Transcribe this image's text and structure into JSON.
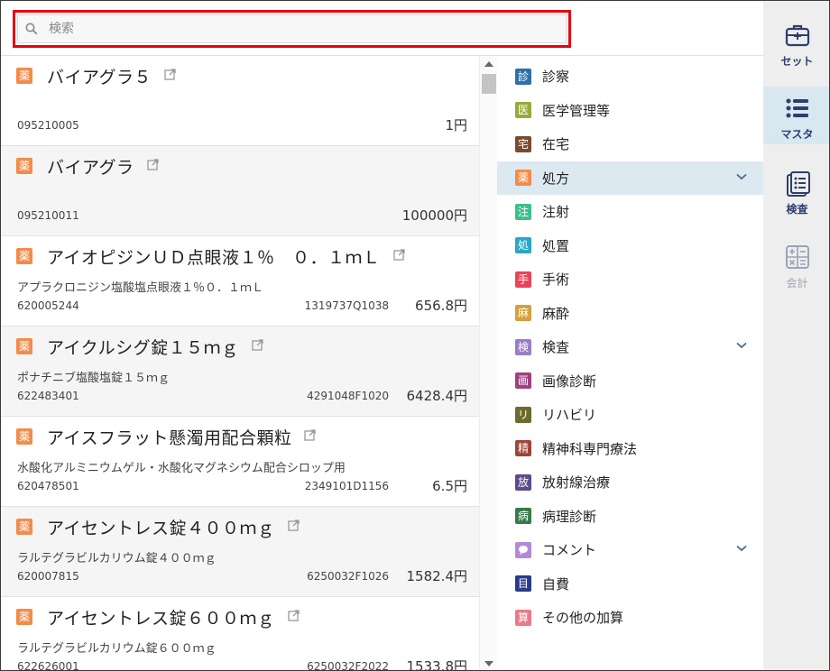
{
  "search": {
    "placeholder": "検索",
    "value": ""
  },
  "items": [
    {
      "badge": "薬",
      "name": "バイアグラ５",
      "desc": "",
      "code": "095210005",
      "code2": "",
      "price": "1円"
    },
    {
      "badge": "薬",
      "name": "バイアグラ",
      "desc": "",
      "code": "095210011",
      "code2": "",
      "price": "100000円"
    },
    {
      "badge": "薬",
      "name": "アイオピジンＵＤ点眼液１％　０．１ｍＬ",
      "desc": "アプラクロニジン塩酸塩点眼液１％０．１ｍＬ",
      "code": "620005244",
      "code2": "1319737Q1038",
      "price": "656.8円"
    },
    {
      "badge": "薬",
      "name": "アイクルシグ錠１５ｍｇ",
      "desc": "ポナチニブ塩酸塩錠１５ｍｇ",
      "code": "622483401",
      "code2": "4291048F1020",
      "price": "6428.4円"
    },
    {
      "badge": "薬",
      "name": "アイスフラット懸濁用配合顆粒",
      "desc": "水酸化アルミニウムゲル・水酸化マグネシウム配合シロップ用",
      "code": "620478501",
      "code2": "2349101D1156",
      "price": "6.5円"
    },
    {
      "badge": "薬",
      "name": "アイセントレス錠４００ｍｇ",
      "desc": "ラルテグラビルカリウム錠４００ｍｇ",
      "code": "620007815",
      "code2": "6250032F1026",
      "price": "1582.4円"
    },
    {
      "badge": "薬",
      "name": "アイセントレス錠６００ｍｇ",
      "desc": "ラルテグラビルカリウム錠６００ｍｇ",
      "code": "622626001",
      "code2": "6250032F2022",
      "price": "1533.8円"
    }
  ],
  "categories": [
    {
      "badge": "診",
      "label": "診察",
      "color": "#2f6fa8",
      "chevron": false
    },
    {
      "badge": "医",
      "label": "医学管理等",
      "color": "#9aa83a",
      "chevron": false
    },
    {
      "badge": "宅",
      "label": "在宅",
      "color": "#7a4a2a",
      "chevron": false
    },
    {
      "badge": "薬",
      "label": "処方",
      "color": "#f28c4a",
      "chevron": true,
      "active": true
    },
    {
      "badge": "注",
      "label": "注射",
      "color": "#3dbf8e",
      "chevron": false
    },
    {
      "badge": "処",
      "label": "処置",
      "color": "#2aa7c4",
      "chevron": false
    },
    {
      "badge": "手",
      "label": "手術",
      "color": "#e8445a",
      "chevron": false
    },
    {
      "badge": "麻",
      "label": "麻酔",
      "color": "#d4a03a",
      "chevron": false
    },
    {
      "badge": "検",
      "label": "検査",
      "color": "#9b7bc6",
      "chevron": true
    },
    {
      "badge": "画",
      "label": "画像診断",
      "color": "#a0407e",
      "chevron": false
    },
    {
      "badge": "リ",
      "label": "リハビリ",
      "color": "#6e6a2c",
      "chevron": false
    },
    {
      "badge": "精",
      "label": "精神科専門療法",
      "color": "#a0443a",
      "chevron": false
    },
    {
      "badge": "放",
      "label": "放射線治療",
      "color": "#5d4a8a",
      "chevron": false
    },
    {
      "badge": "病",
      "label": "病理診断",
      "color": "#3a7a4a",
      "chevron": false
    },
    {
      "badge": "💬",
      "label": "コメント",
      "color": "#b48ad6",
      "chevron": true
    },
    {
      "badge": "目",
      "label": "自費",
      "color": "#2a3a8a",
      "chevron": false
    },
    {
      "badge": "算",
      "label": "その他の加算",
      "color": "#e87a8a",
      "chevron": false
    }
  ],
  "rail": [
    {
      "label": "セット",
      "icon": "toolbox-icon"
    },
    {
      "label": "マスタ",
      "icon": "list-icon",
      "active": true
    },
    {
      "label": "検査",
      "icon": "checklist-icon"
    },
    {
      "label": "会計",
      "icon": "calculator-icon",
      "disabled": true
    }
  ]
}
